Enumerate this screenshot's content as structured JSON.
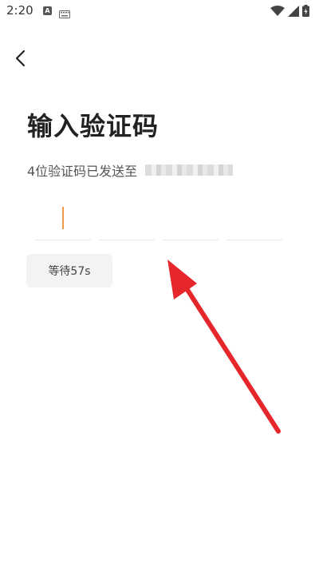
{
  "status_bar": {
    "time": "2:20",
    "notif_letter": "A"
  },
  "page": {
    "title": "输入验证码",
    "sent_text": "4位验证码已发送至",
    "code_digits": [
      "",
      "",
      "",
      ""
    ],
    "wait_button_label": "等待57s"
  },
  "colors": {
    "caret": "#f29a49",
    "annotation_arrow": "#e5262b",
    "wait_button_bg": "#f3f3f3"
  },
  "icons": {
    "back": "chevron-left-icon",
    "wifi": "wifi-icon",
    "signal": "signal-icon",
    "battery": "battery-charging-icon",
    "keyboard": "keyboard-icon"
  }
}
